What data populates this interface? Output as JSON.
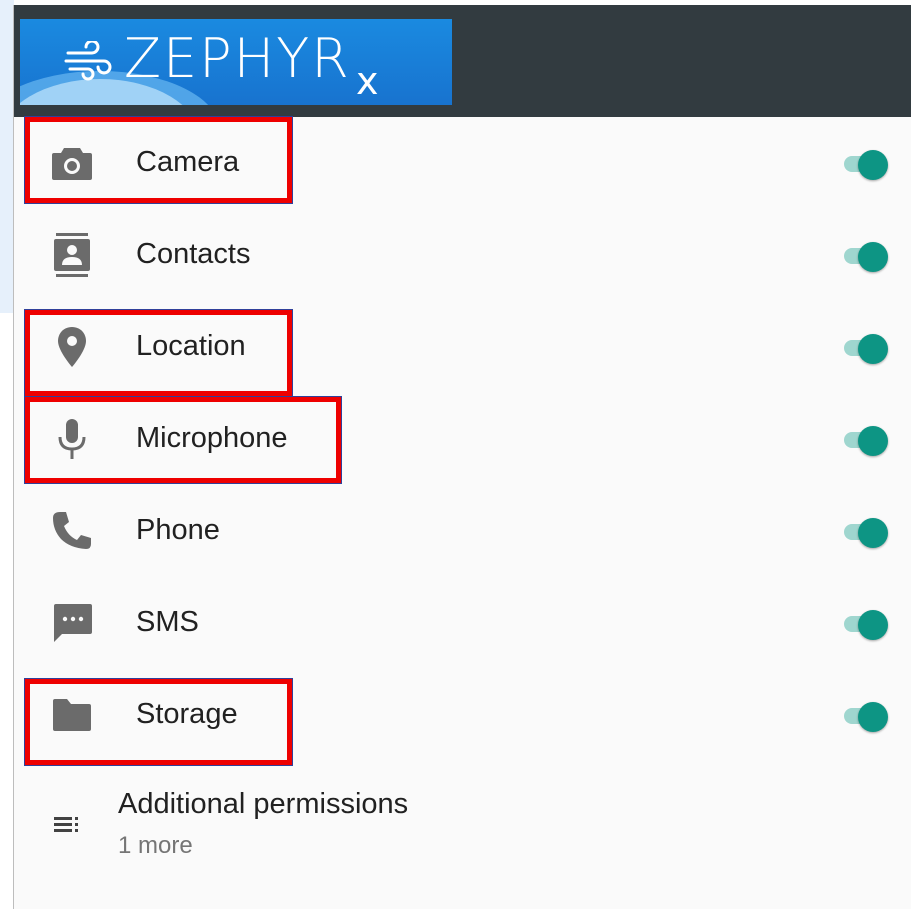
{
  "brand": {
    "logo_text": "ZEPHYR",
    "logo_sub": "x"
  },
  "permissions": [
    {
      "label": "Camera",
      "icon": "camera-icon",
      "enabled": true,
      "highlighted": true
    },
    {
      "label": "Contacts",
      "icon": "contacts-icon",
      "enabled": true,
      "highlighted": false
    },
    {
      "label": "Location",
      "icon": "location-icon",
      "enabled": true,
      "highlighted": true
    },
    {
      "label": "Microphone",
      "icon": "microphone-icon",
      "enabled": true,
      "highlighted": true
    },
    {
      "label": "Phone",
      "icon": "phone-icon",
      "enabled": true,
      "highlighted": false
    },
    {
      "label": "SMS",
      "icon": "sms-icon",
      "enabled": true,
      "highlighted": false
    },
    {
      "label": "Storage",
      "icon": "folder-icon",
      "enabled": true,
      "highlighted": true
    }
  ],
  "additional": {
    "title": "Additional permissions",
    "subtitle": "1 more",
    "icon": "list-icon"
  },
  "colors": {
    "toggle_thumb": "#0d9584",
    "toggle_track": "#9fd6cf",
    "highlight_border": "#ee0000",
    "topbar": "#323b40",
    "logo_bg": "#1873cf"
  }
}
